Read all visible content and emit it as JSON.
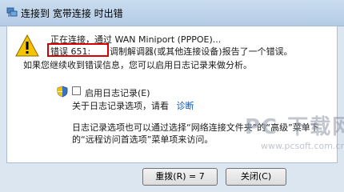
{
  "window": {
    "title": "连接到 宽带连接 时出错"
  },
  "message": {
    "status_line": "正在连接，通过 WAN Miniport (PPPOE)...",
    "error_code": "错误 651:",
    "error_text": "调制解调器(或其他连接设备)报告了一个错误。",
    "hint": "如果您继续收到错误信息，您可以启用日志记录来做分析。"
  },
  "logging": {
    "checkbox_label": "启用日志记录(E)",
    "checked": false,
    "about_text": "关于日志记录选项，请看",
    "diagnose_link": "诊断",
    "note_line1": "日志记录选项也可以通过选择“网络连接文件夹”的“高级”菜单下",
    "note_line2": "的“远程访问首选项”菜单项来访问。"
  },
  "buttons": {
    "redial_label": "重拨(R) = 7",
    "close_label": "关闭(C)"
  },
  "watermark": {
    "text": "PC 下载网",
    "url": "www.pcsoft.com.cn"
  },
  "colors": {
    "error_highlight": "#d40000",
    "link": "#0c52b6",
    "background": "#dbe6f1"
  },
  "icons": [
    "network-connection-icon",
    "warning-icon",
    "uac-shield-icon"
  ]
}
